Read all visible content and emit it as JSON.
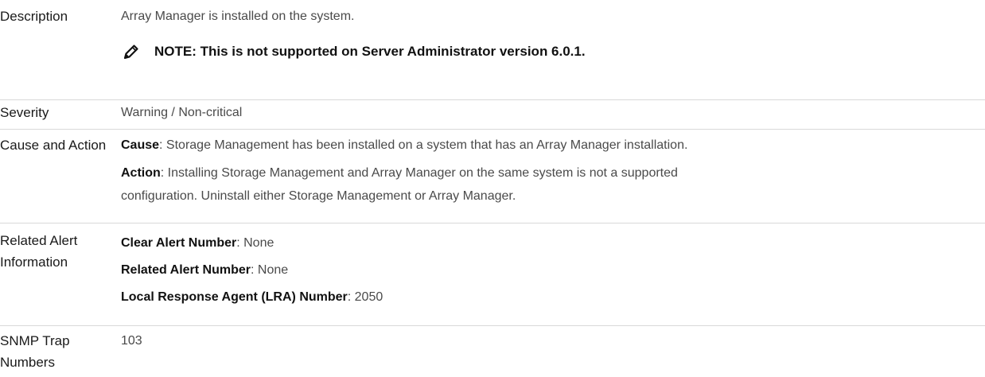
{
  "rows": {
    "description": {
      "label": "Description",
      "text": "Array Manager is installed on the system.",
      "note": "NOTE: This is not supported on Server Administrator version 6.0.1."
    },
    "severity": {
      "label": "Severity",
      "text": "Warning / Non-critical"
    },
    "cause_action": {
      "label": "Cause and Action",
      "cause_key": "Cause",
      "cause_text": ": Storage Management has been installed on a system that has an Array Manager installation.",
      "action_key": "Action",
      "action_line1": ": Installing Storage Management and Array Manager on the same system is not a supported",
      "action_line2": "configuration. Uninstall either Storage Management or Array Manager."
    },
    "related": {
      "label_line1": "Related Alert",
      "label_line2": "Information",
      "clear_key": "Clear Alert Number",
      "clear_val": ": None",
      "related_key": "Related Alert Number",
      "related_val": ": None",
      "lra_key": "Local Response Agent (LRA) Number",
      "lra_val": ": 2050"
    },
    "snmp": {
      "label_line1": "SNMP Trap",
      "label_line2": "Numbers",
      "text": "103"
    }
  },
  "colors": {
    "divider": "#d9d9d9",
    "label": "#1a1a1a",
    "body": "#4a4a4a"
  },
  "icons": {
    "note": "pencil-note-icon"
  }
}
